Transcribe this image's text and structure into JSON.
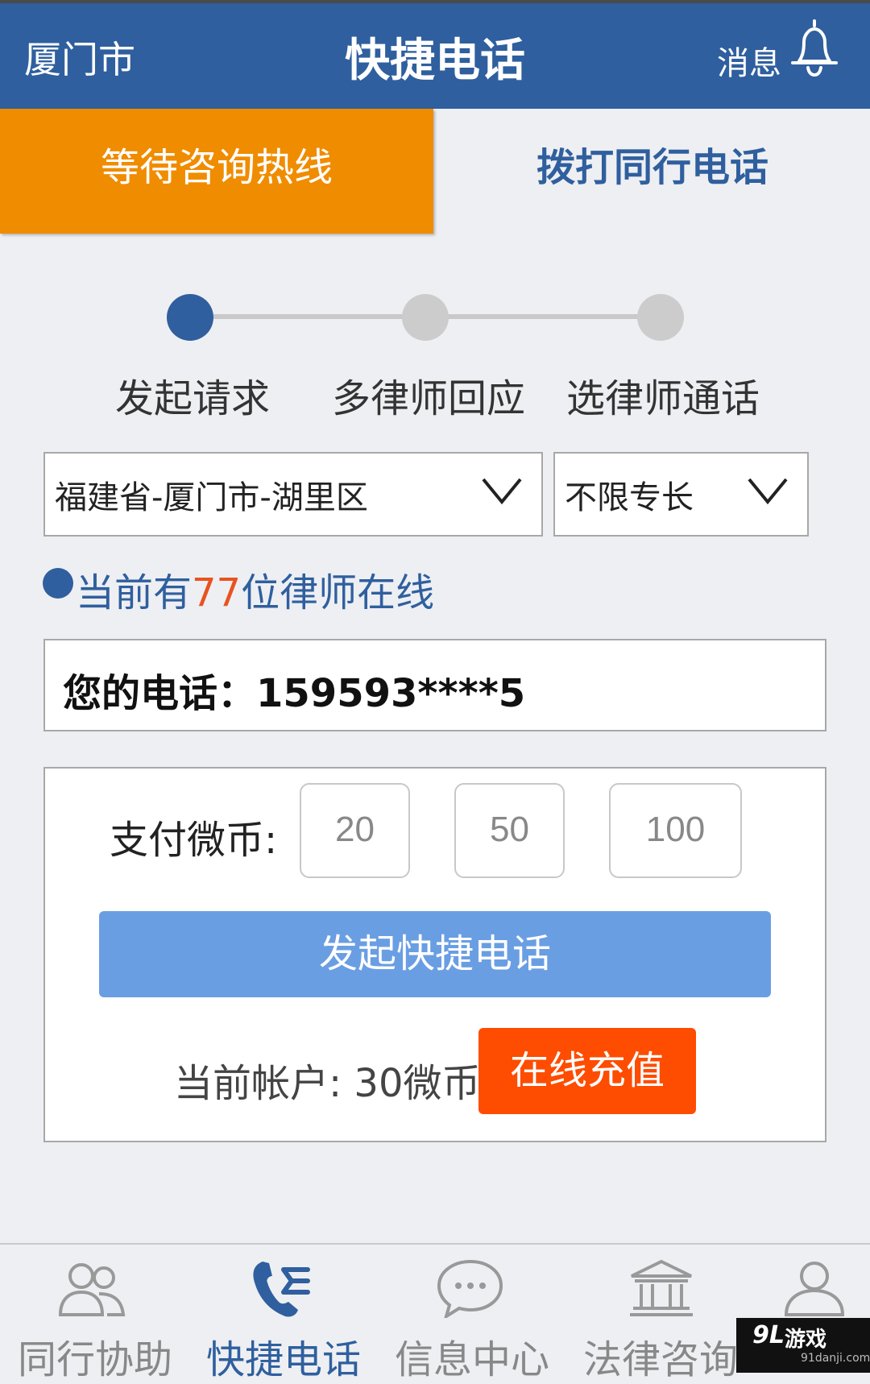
{
  "header": {
    "city": "厦门市",
    "title": "快捷电话",
    "message_label": "消息"
  },
  "tabs": [
    {
      "label": "等待咨询热线",
      "active": true
    },
    {
      "label": "拨打同行电话",
      "active": false
    }
  ],
  "steps": [
    {
      "label": "发起请求",
      "active": true
    },
    {
      "label": "多律师回应",
      "active": false
    },
    {
      "label": "选律师通话",
      "active": false
    }
  ],
  "filters": {
    "region": "福建省-厦门市-湖里区",
    "specialty": "不限专长"
  },
  "online": {
    "prefix": "当前有",
    "count": "77",
    "suffix": "位律师在线"
  },
  "phone": {
    "text": "您的电话：159593****5"
  },
  "payment": {
    "label": "支付微币:",
    "options": [
      "20",
      "50",
      "100"
    ],
    "start_button": "发起快捷电话",
    "balance": "当前帐户: 30微币",
    "recharge_button": "在线充值"
  },
  "nav": [
    {
      "label": "同行协助",
      "icon": "users-icon",
      "active": false
    },
    {
      "label": "快捷电话",
      "icon": "phone-icon",
      "active": true
    },
    {
      "label": "信息中心",
      "icon": "chat-icon",
      "active": false
    },
    {
      "label": "法律咨询",
      "icon": "courthouse-icon",
      "active": false
    },
    {
      "label": "",
      "icon": "user-icon",
      "active": false
    }
  ],
  "watermark": {
    "logo": "9L",
    "name": "游戏",
    "url": "91danji.com"
  },
  "colors": {
    "primary": "#2f5f9e",
    "tab_active": "#f08c00",
    "button_blue": "#6a9ee3",
    "recharge": "#fe4c00",
    "highlight": "#e8531f"
  }
}
